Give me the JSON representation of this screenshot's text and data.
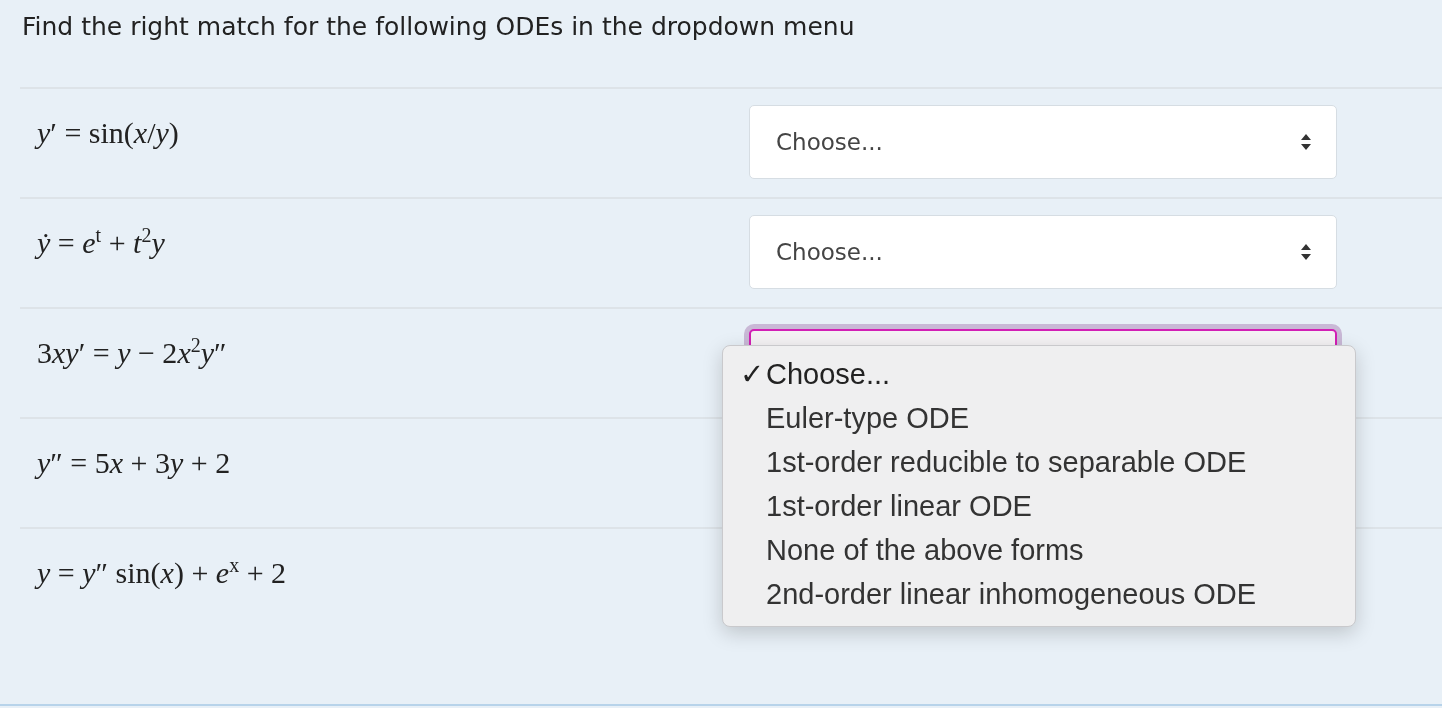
{
  "question": {
    "prompt": "Find the right match for the following ODEs in the dropdown menu"
  },
  "rows": [
    {
      "equation": [
        "*y*′ = sin(*x*/*y*)"
      ],
      "select": {
        "value": "Choose...",
        "focused": false
      }
    },
    {
      "equation": [
        "*ẏ* = *e*$^{t}$ + *t*$^{2}$*y*"
      ],
      "select": {
        "value": "Choose...",
        "focused": false
      }
    },
    {
      "equation": [
        "3",
        "*xy*′ = *y* − 2",
        "*x*$^{2}$*y*″"
      ],
      "select": {
        "focused": true
      }
    },
    {
      "equation": [
        "*y*″ = 5",
        "*x* + 3",
        "*y* + 2"
      ]
    },
    {
      "equation": [
        "*y* = *y*″ sin(*x*) + *e*$^{x}$ + 2"
      ]
    }
  ],
  "dropdown_menu": {
    "options": [
      {
        "label": "✓",
        "text": "Choose...",
        "selected": true
      },
      {
        "text": "Euler-type ODE",
        "selected": false
      },
      {
        "text": "1st-order reducible to separable ODE",
        "selected": false
      },
      {
        "text": "1st-order linear ODE",
        "selected": false
      },
      {
        "text": "None of the above forms",
        "selected": false
      },
      {
        "text": "2nd-order linear inhomogeneous ODE",
        "selected": false
      }
    ]
  }
}
